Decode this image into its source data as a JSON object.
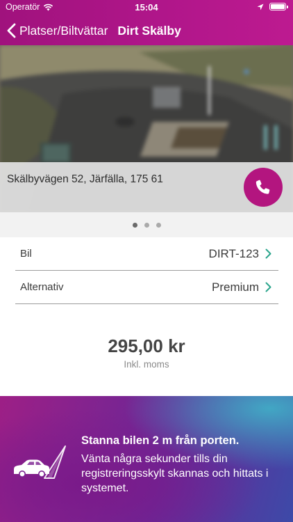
{
  "status_bar": {
    "carrier": "Operatör",
    "time": "15:04"
  },
  "nav": {
    "back_label": "Platser/Biltvättar",
    "title": "Dirt Skälby"
  },
  "location": {
    "address": "Skälbyvägen 52, Järfälla, 175 61"
  },
  "pager": {
    "count": 3,
    "active_index": 0
  },
  "options": {
    "car": {
      "label": "Bil",
      "value": "DIRT-123"
    },
    "alternative": {
      "label": "Alternativ",
      "value": "Premium"
    }
  },
  "price": {
    "amount": "295,00 kr",
    "note": "Inkl. moms"
  },
  "instruction": {
    "title": "Stanna bilen 2 m från porten.",
    "text": "Vänta några sekunder tills din registreringsskylt skannas och hittats i systemet."
  },
  "colors": {
    "brand": "#b3157f",
    "chevron": "#2aa58c"
  }
}
